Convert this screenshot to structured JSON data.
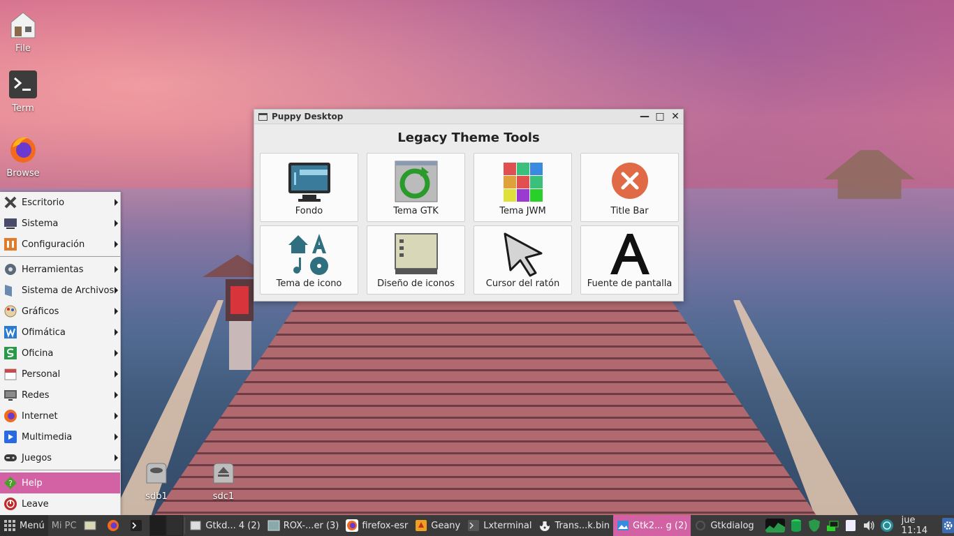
{
  "desktop_icons": [
    {
      "label": "File",
      "icon": "file-manager-icon"
    },
    {
      "label": "Term",
      "icon": "terminal-icon"
    },
    {
      "label": "Browse",
      "icon": "firefox-icon"
    }
  ],
  "drives": [
    {
      "label": "sdb1",
      "icon": "hard-drive-icon"
    },
    {
      "label": "sdc1",
      "icon": "eject-drive-icon"
    }
  ],
  "window": {
    "title": "Puppy Desktop",
    "heading": "Legacy Theme Tools",
    "buttons": {
      "minimize": "—",
      "maximize": "□",
      "close": "✕"
    },
    "tools": [
      {
        "label": "Fondo",
        "icon": "wallpaper-icon"
      },
      {
        "label": "Tema GTK",
        "icon": "gtk-theme-icon"
      },
      {
        "label": "Tema JWM",
        "icon": "jwm-theme-icon"
      },
      {
        "label": "Title Bar",
        "icon": "title-bar-icon"
      },
      {
        "label": "Tema de icono",
        "icon": "icon-theme-icon"
      },
      {
        "label": "Diseño de iconos",
        "icon": "icon-layout-icon"
      },
      {
        "label": "Cursor del ratón",
        "icon": "mouse-cursor-icon"
      },
      {
        "label": "Fuente de pantalla",
        "icon": "screen-font-icon"
      }
    ]
  },
  "menu": {
    "group1": [
      {
        "label": "Escritorio",
        "icon": "desktop-icon",
        "color": "#3a3a3a"
      },
      {
        "label": "Sistema",
        "icon": "system-icon",
        "color": "#4a4a6a"
      },
      {
        "label": "Configuración",
        "icon": "settings-icon",
        "color": "#e07b2a"
      }
    ],
    "group2": [
      {
        "label": "Herramientas",
        "icon": "tools-icon",
        "color": "#5a6a7a"
      },
      {
        "label": "Sistema de Archivos",
        "icon": "filesystem-icon",
        "color": "#6a8ab0"
      },
      {
        "label": "Gráficos",
        "icon": "graphics-icon",
        "color": "#c9a86a"
      },
      {
        "label": "Ofimática",
        "icon": "office-icon",
        "color": "#2a7ad0"
      },
      {
        "label": "Oficina",
        "icon": "spreadsheet-icon",
        "color": "#2a9a4a"
      },
      {
        "label": "Personal",
        "icon": "calendar-icon",
        "color": "#c84a4a"
      },
      {
        "label": "Redes",
        "icon": "network-icon",
        "color": "#5a5a5a"
      },
      {
        "label": "Internet",
        "icon": "internet-icon",
        "color": "#e86a20"
      },
      {
        "label": "Multimedia",
        "icon": "multimedia-icon",
        "color": "#2a6ae0"
      },
      {
        "label": "Juegos",
        "icon": "games-icon",
        "color": "#3a3a3a"
      }
    ],
    "group3": [
      {
        "label": "Help",
        "icon": "help-icon",
        "color": "#4aa02a"
      },
      {
        "label": "Leave",
        "icon": "power-icon",
        "color": "#c02a2a"
      }
    ]
  },
  "taskbar": {
    "menu_label": "Menú",
    "mypc_label": "Mi PC",
    "tasks": [
      {
        "label": "Gtkd...  4 (2)",
        "icon": "window-icon",
        "active": false
      },
      {
        "label": "ROX-...er (3)",
        "icon": "rox-icon",
        "active": false
      },
      {
        "label": "firefox-esr",
        "icon": "firefox-icon",
        "active": false
      },
      {
        "label": "Geany",
        "icon": "geany-icon",
        "active": false
      },
      {
        "label": "Lxterminal",
        "icon": "terminal-icon",
        "active": false
      },
      {
        "label": "Trans...k.bin",
        "icon": "puppy-icon",
        "active": false
      },
      {
        "label": "Gtk2...  g (2)",
        "icon": "gtk-icon",
        "active": true
      },
      {
        "label": "Gtkdialog",
        "icon": "refresh-icon",
        "active": false
      }
    ],
    "clock": "jue 11:14"
  }
}
